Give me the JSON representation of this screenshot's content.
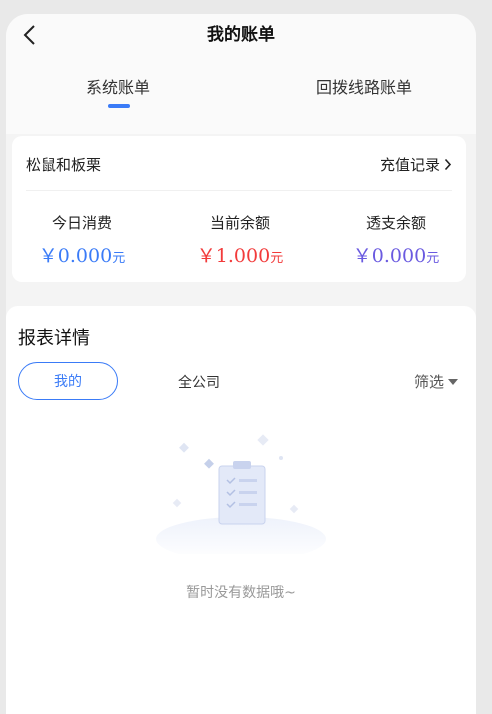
{
  "header": {
    "title": "我的账单",
    "tabs": [
      {
        "label": "系统账单",
        "active": true
      },
      {
        "label": "回拨线路账单",
        "active": false
      }
    ],
    "accent": "#3a7bf7"
  },
  "account": {
    "name": "松鼠和板栗",
    "recharge_label": "充值记录",
    "stats": [
      {
        "label": "今日消费",
        "value": "￥0.000",
        "unit": "元",
        "color": "#3a7bf7"
      },
      {
        "label": "当前余额",
        "value": "￥1.000",
        "unit": "元",
        "color": "#f23b3b"
      },
      {
        "label": "透支余额",
        "value": "￥0.000",
        "unit": "元",
        "color": "#6a5ae0"
      }
    ]
  },
  "report": {
    "title": "报表详情",
    "filters": {
      "mine": "我的",
      "company": "全公司",
      "filter": "筛选"
    },
    "empty_text": "暂时没有数据哦~"
  }
}
